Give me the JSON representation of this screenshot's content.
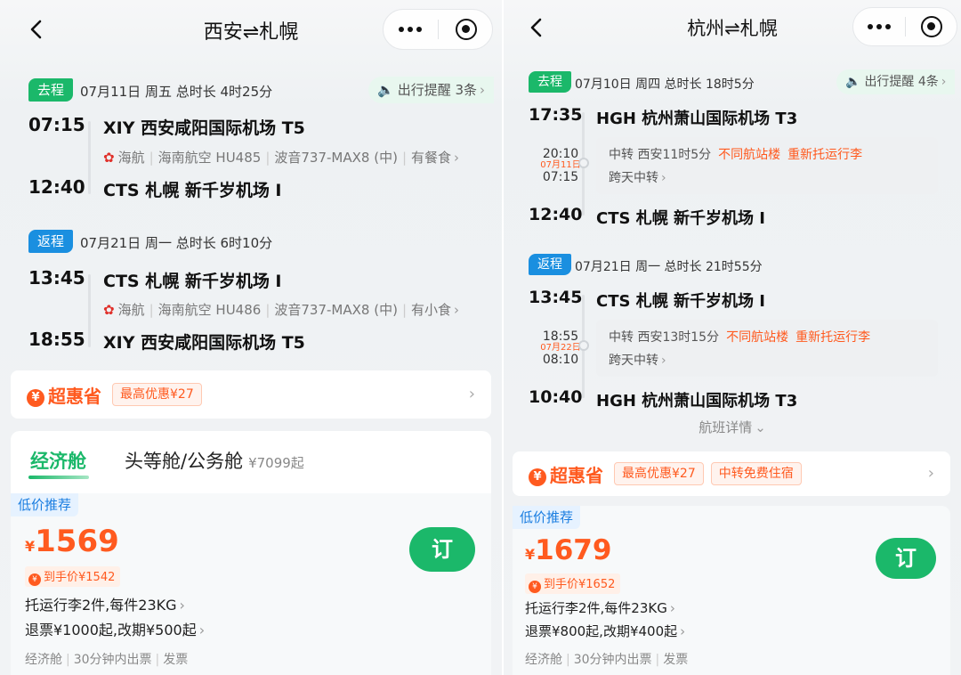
{
  "left": {
    "title": "西安⇌札幌",
    "outbound": {
      "tag": "去程",
      "info": "07月11日 周五  总时长 4时25分",
      "reminder": "出行提醒 3条",
      "dep_time": "07:15",
      "dep_airport": "XIY 西安咸阳国际机场 T5",
      "carrier_logo": "海航",
      "carrier_sep1": "|",
      "carrier_airline": "海南航空 HU485",
      "carrier_sep2": "|",
      "carrier_plane": "波音737-MAX8 (中)",
      "carrier_sep3": "|",
      "carrier_meal": "有餐食",
      "arr_time": "12:40",
      "arr_airport": "CTS 札幌 新千岁机场 I"
    },
    "return": {
      "tag": "返程",
      "info": "07月21日 周一  总时长 6时10分",
      "dep_time": "13:45",
      "dep_airport": "CTS 札幌 新千岁机场 I",
      "carrier_logo": "海航",
      "carrier_sep1": "|",
      "carrier_airline": "海南航空 HU486",
      "carrier_sep2": "|",
      "carrier_plane": "波音737-MAX8 (中)",
      "carrier_sep3": "|",
      "carrier_meal": "有小食",
      "arr_time": "18:55",
      "arr_airport": "XIY 西安咸阳国际机场 T5"
    },
    "promo": {
      "brand": "超惠省",
      "chip1": "最高优惠¥27"
    },
    "tabs": {
      "economy": "经济舱",
      "first": "头等舱/公务舱",
      "first_sub": "¥7099起"
    },
    "fare": {
      "tag": "低价推荐",
      "currency": "¥",
      "price": "1569",
      "final": "到手价¥1542",
      "baggage": "托运行李2件,每件23KG",
      "refund": "退票¥1000起,改期¥500起",
      "meta1": "经济舱",
      "meta_sep1": "|",
      "meta2": "30分钟内出票",
      "meta_sep2": "|",
      "meta3": "发票",
      "book": "订"
    }
  },
  "right": {
    "title": "杭州⇌札幌",
    "outbound": {
      "tag": "去程",
      "info": "07月10日 周四  总时长 18时5分",
      "reminder": "出行提醒 4条",
      "dep_time": "17:35",
      "dep_airport": "HGH 杭州萧山国际机场 T3",
      "tf_arr": "20:10",
      "tf_date": "07月11日",
      "tf_dep": "07:15",
      "tf_line1": "中转  西安11时5分",
      "tf_diff_terminal": "不同航站楼",
      "tf_recheck": "重新托运行李",
      "tf_line2": "跨天中转",
      "arr_time": "12:40",
      "arr_airport": "CTS 札幌 新千岁机场 I"
    },
    "return": {
      "tag": "返程",
      "info": "07月21日 周一  总时长 21时55分",
      "dep_time": "13:45",
      "dep_airport": "CTS 札幌 新千岁机场 I",
      "tf_arr": "18:55",
      "tf_date": "07月22日",
      "tf_dep": "08:10",
      "tf_line1": "中转  西安13时15分",
      "tf_diff_terminal": "不同航站楼",
      "tf_recheck": "重新托运行李",
      "tf_line2": "跨天中转",
      "arr_time": "10:40",
      "arr_airport": "HGH 杭州萧山国际机场 T3"
    },
    "details": "航班详情",
    "promo": {
      "brand": "超惠省",
      "chip1": "最高优惠¥27",
      "chip2": "中转免费住宿"
    },
    "fare": {
      "tag": "低价推荐",
      "currency": "¥",
      "price": "1679",
      "final": "到手价¥1652",
      "baggage": "托运行李2件,每件23KG",
      "refund": "退票¥800起,改期¥400起",
      "meta1": "经济舱",
      "meta_sep1": "|",
      "meta2": "30分钟内出票",
      "meta_sep2": "|",
      "meta3": "发票",
      "book": "订"
    }
  },
  "colors": {
    "green": "#1bb86a",
    "blue": "#1a8fe0",
    "orange": "#ff5a1f"
  },
  "icons": [
    "back-icon",
    "more-icon",
    "target-icon",
    "speaker-icon",
    "airline-logo-icon",
    "chevron-right-icon",
    "chevron-down-icon",
    "promo-icon"
  ]
}
